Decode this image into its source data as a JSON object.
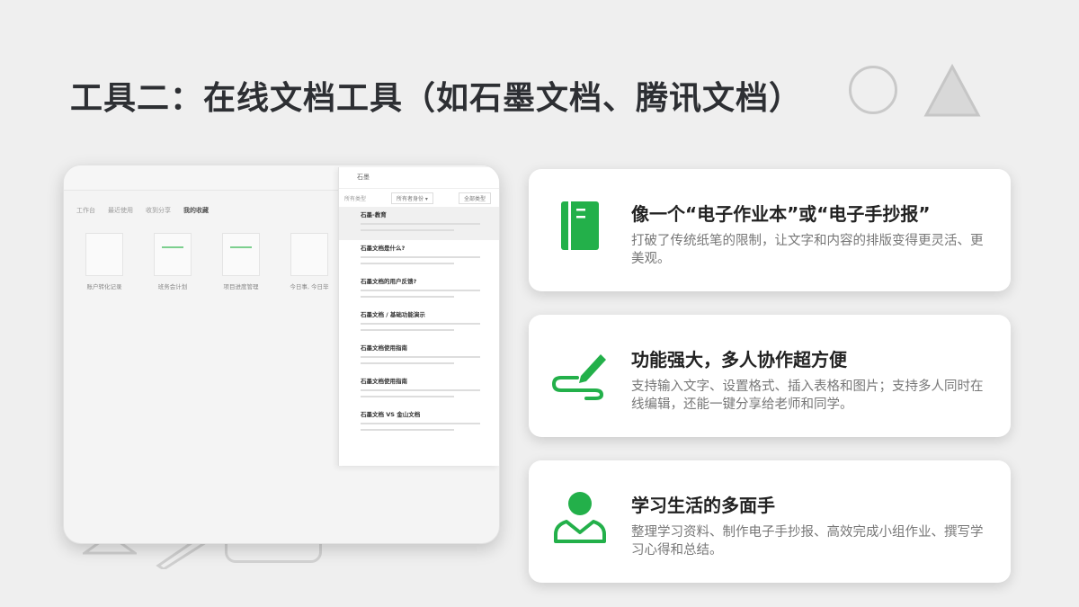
{
  "slide": {
    "title": "工具二：在线文档工具（如石墨文档、腾讯文档）"
  },
  "colors": {
    "accent": "#23b04a",
    "title": "#2d2f33",
    "desc": "#777777",
    "background": "#efefef"
  },
  "screenshot": {
    "tabs": [
      "工作台",
      "最近使用",
      "收到分享",
      "我的收藏"
    ],
    "docs": [
      {
        "label": "账户转化记录"
      },
      {
        "label": "班务会计划"
      },
      {
        "label": "项目进度管理"
      },
      {
        "label": "今日事, 今日毕"
      }
    ],
    "search_text": "石墨",
    "filters": [
      "所有类型",
      "所有者身份 ▾",
      "全部类型"
    ],
    "results": [
      {
        "title": "石墨-教育"
      },
      {
        "title": "石墨文档是什么?"
      },
      {
        "title": "石墨文档的用户反馈?"
      },
      {
        "title": "石墨文档 / 基础功能演示"
      },
      {
        "title": "石墨文档使用指南"
      },
      {
        "title": "石墨文档使用指南"
      },
      {
        "title": "石墨文档 VS 金山文档"
      }
    ]
  },
  "cards": [
    {
      "icon": "notebook-icon",
      "title": "像一个“电子作业本”或“电子手抄报”",
      "desc": "打破了传统纸笔的限制，让文字和内容的排版变得更灵活、更美观。"
    },
    {
      "icon": "pen-icon",
      "title": "功能强大，多人协作超方便",
      "desc": "支持输入文字、设置格式、插入表格和图片；支持多人同时在线编辑，还能一键分享给老师和同学。"
    },
    {
      "icon": "person-icon",
      "title": "学习生活的多面手",
      "desc": "整理学习资料、制作电子手抄报、高效完成小组作业、撰写学习心得和总结。"
    }
  ]
}
